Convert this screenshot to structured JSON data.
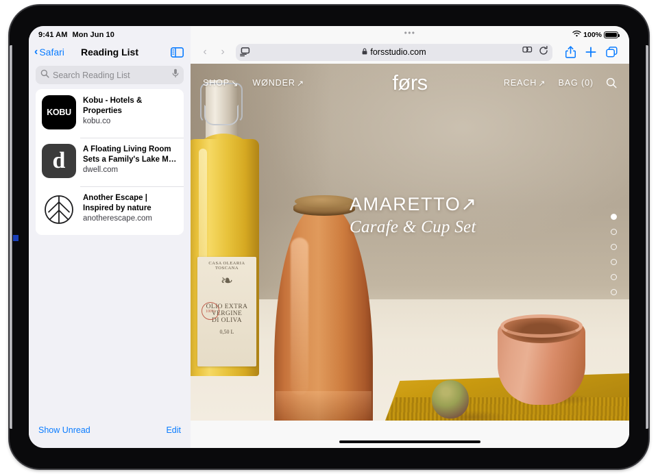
{
  "status_bar": {
    "time": "9:41 AM",
    "date": "Mon Jun 10",
    "wifi_icon": "wifi-icon",
    "battery_percent": "100%",
    "battery_level": 100
  },
  "sidebar": {
    "back_label": "Safari",
    "back_icon": "chevron-left-icon",
    "title": "Reading List",
    "toggle_icon": "sidebar-toggle-icon",
    "search": {
      "placeholder": "Search Reading List",
      "value": "",
      "icon": "search-icon",
      "dictation_icon": "microphone-icon"
    },
    "items": [
      {
        "title": "Kobu - Hotels & Properties",
        "url": "kobu.co",
        "icon_name": "kobu-favicon",
        "icon_text": "KOBU"
      },
      {
        "title": "A Floating Living Room Sets a Family's Lake M…",
        "url": "dwell.com",
        "icon_name": "dwell-favicon",
        "icon_text": "d"
      },
      {
        "title": "Another Escape | Inspired by nature",
        "url": "anotherescape.com",
        "icon_name": "anotherescape-favicon",
        "icon_text": ""
      }
    ],
    "footer": {
      "show_unread_label": "Show Unread",
      "edit_label": "Edit"
    }
  },
  "browser": {
    "multitask_icon": "multitasking-dots-icon",
    "back_icon": "back-arrow-icon",
    "forward_icon": "forward-arrow-icon",
    "reader_icon": "reader-view-icon",
    "lock_icon": "lock-icon",
    "url": "forsstudio.com",
    "extensions_icon": "extensions-icon",
    "reload_icon": "reload-icon",
    "share_icon": "share-icon",
    "new_tab_icon": "plus-icon",
    "tabs_icon": "tab-overview-icon"
  },
  "webpage": {
    "brand": "førs",
    "nav_left": [
      {
        "label": "SHOP",
        "arrow": "↘",
        "name": "shop"
      },
      {
        "label": "WØNDER",
        "arrow": "↗",
        "name": "wonder"
      }
    ],
    "nav_right": [
      {
        "label": "REACH",
        "arrow": "↗",
        "name": "reach"
      },
      {
        "label": "BAG (0)",
        "arrow": "",
        "name": "bag"
      }
    ],
    "search_icon": "search-icon",
    "hero": {
      "title": "AMARETTO",
      "title_arrow": "↗",
      "subtitle": "Carafe & Cup Set"
    },
    "pagination": {
      "total": 6,
      "active_index": 0
    },
    "product_photo": {
      "bottle_label": {
        "brand": "CASA OLEARIA TOSCANA",
        "stamp": "100%",
        "line1": "OLIO EXTRA",
        "line2": "VERGINE",
        "line3": "DI OLIVA",
        "volume": "0,50 L"
      }
    },
    "colors": {
      "background": "#b3a795",
      "carafe": "#cd7c3e",
      "cup": "#dc9a78",
      "cloth": "#c8990f",
      "text": "#ffffff"
    }
  },
  "accent_color": "#0a7cff"
}
